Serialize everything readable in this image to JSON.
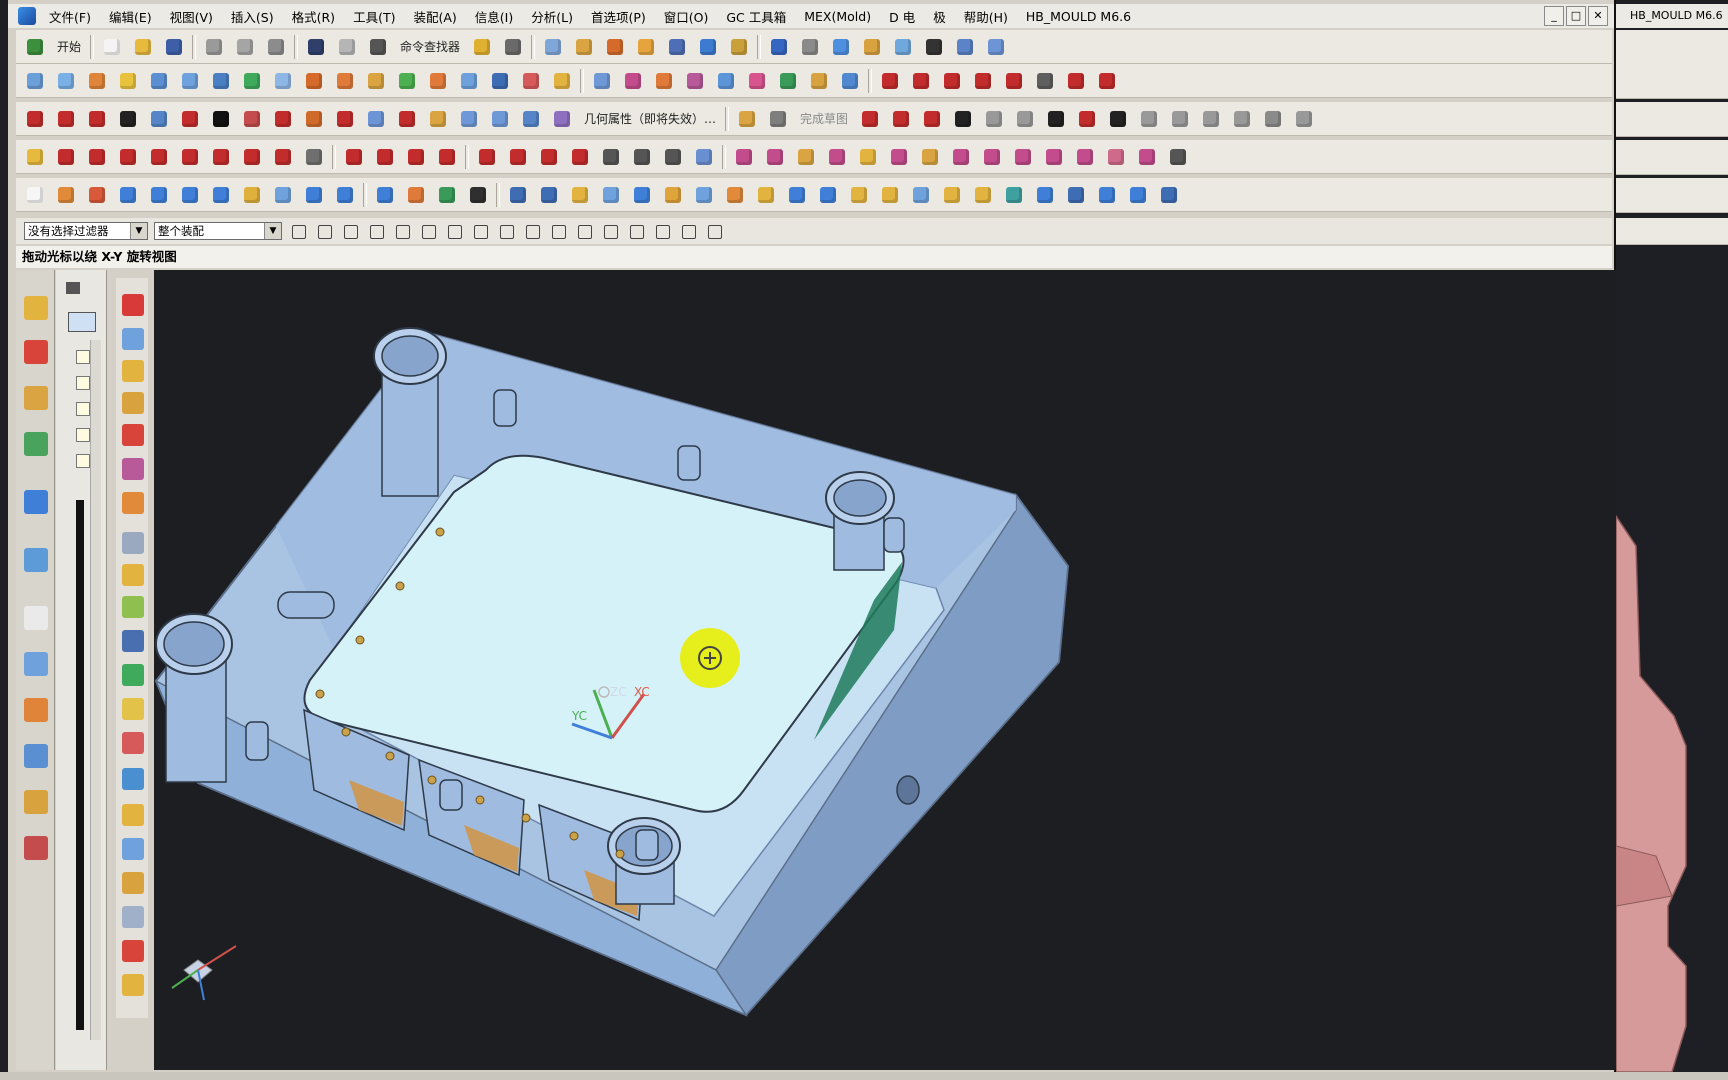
{
  "menubar": {
    "items": [
      "文件(F)",
      "编辑(E)",
      "视图(V)",
      "插入(S)",
      "格式(R)",
      "工具(T)",
      "装配(A)",
      "信息(I)",
      "分析(L)",
      "首选项(P)",
      "窗口(O)",
      "GC 工具箱",
      "MEX(Mold)",
      "D 电",
      "极",
      "帮助(H)",
      "HB_MOULD M6.6"
    ],
    "window_controls": [
      "_",
      "□",
      "✕"
    ]
  },
  "toolbar1": {
    "start_label": "开始",
    "command_finder_label": "命令查找器"
  },
  "toolbar3": {
    "geometry_props_label": "几何属性（即将失效）…",
    "finish_sketch_label": "完成草图"
  },
  "filterbar": {
    "selection_filter": "没有选择过滤器",
    "scope": "整个装配"
  },
  "cue": "拖动光标以绕 X-Y 旋转视图",
  "viewport": {
    "triad_labels": {
      "zc": "ZC",
      "xc": "XC",
      "yc": "YC"
    },
    "colors": {
      "background": "#1c1e22",
      "plate": "#a9c3e3",
      "plate_dark": "#7f9cc4",
      "insert_top": "#d6f2f9",
      "rotate_cursor": "#e6ee1c"
    }
  },
  "secondary_window": {
    "menu_title": "HB_MOULD M6.6"
  },
  "colors": {
    "chrome": "#d4d0c8",
    "toolbar": "#ebe9e2",
    "accent": "#3a8ee6"
  }
}
